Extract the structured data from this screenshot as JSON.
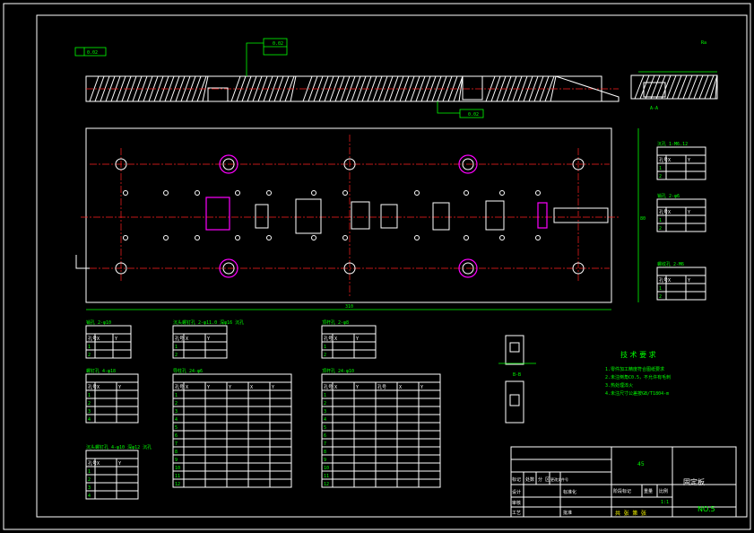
{
  "title_block": {
    "drawing_name": "固定板",
    "drawing_no": "NO.5",
    "material": "45",
    "scale": "1:1",
    "sheet_info": "共 张 第 张",
    "header_cells": [
      "标记",
      "处数",
      "分 区",
      "更改文件号"
    ],
    "right_headers": [
      "阶段标记",
      "重量",
      "比例"
    ],
    "left_rows": [
      "设计",
      "审核",
      "工艺"
    ],
    "design_value": "标准化",
    "approve_label": "批准"
  },
  "tech_req": {
    "title": "技 术 要 求",
    "lines": [
      "1.零件加工精度符合图纸要求",
      "2.未注倒角C0.5，不允许有毛刺",
      "3.热处理淬火",
      "4.未注尺寸公差按GB/T1804-m"
    ]
  },
  "labels": {
    "flatness": "0.02",
    "parallel": "0.02",
    "perp": "0.02",
    "roughness": "Ra",
    "section_aa": "A-A",
    "section_bb": "B-B",
    "dim_total": "310",
    "dim_height": "80"
  },
  "tables": {
    "t_sr": {
      "title": "沉孔 1-M6.12",
      "headers": [
        "孔号",
        "X",
        "Y"
      ],
      "rows": [
        [
          "1",
          "",
          ""
        ],
        [
          "2",
          "",
          ""
        ]
      ]
    },
    "t_r1": {
      "title": "销孔 2-φ6",
      "headers": [
        "孔号",
        "X",
        "Y"
      ],
      "rows": [
        [
          "1",
          "",
          ""
        ],
        [
          "2",
          "",
          ""
        ]
      ]
    },
    "t_r2": {
      "title": "螺纹孔 2-M6",
      "headers": [
        "孔号",
        "X",
        "Y"
      ],
      "rows": [
        [
          "1",
          "",
          ""
        ],
        [
          "2",
          "",
          ""
        ]
      ]
    },
    "t_a": {
      "title": "销孔 2-φ10",
      "headers": [
        "孔号",
        "X",
        "Y"
      ],
      "rows": [
        [
          "1",
          "",
          ""
        ],
        [
          "2",
          "",
          ""
        ]
      ]
    },
    "t_b": {
      "title": "沉头螺钉孔 2-φ11.0 深φ16 沉孔",
      "headers": [
        "孔号",
        "X",
        "Y"
      ],
      "rows": [
        [
          "1",
          "",
          ""
        ],
        [
          "2",
          "",
          ""
        ]
      ]
    },
    "t_c": {
      "title": "顶杆孔 2-φ8",
      "headers": [
        "孔号",
        "X",
        "Y"
      ],
      "rows": [
        [
          "1",
          "",
          ""
        ],
        [
          "2",
          "",
          ""
        ]
      ]
    },
    "t_d": {
      "title": "螺钉孔 4-φ18",
      "headers": [
        "孔号",
        "X",
        "Y"
      ],
      "rows": [
        [
          "1",
          "",
          ""
        ],
        [
          "2",
          "",
          ""
        ],
        [
          "3",
          "",
          ""
        ],
        [
          "4",
          "",
          ""
        ]
      ]
    },
    "t_e": {
      "title": "沉头螺钉孔 4-φ10 深φ12 沉孔",
      "headers": [
        "孔号",
        "X",
        "Y"
      ],
      "rows": [
        [
          "1",
          "",
          ""
        ],
        [
          "2",
          "",
          ""
        ],
        [
          "3",
          "",
          ""
        ],
        [
          "4",
          "",
          ""
        ]
      ]
    },
    "t_f": {
      "title": "导柱孔 24-φ6",
      "headers": [
        "孔号",
        "X",
        "Y",
        "Y",
        "X",
        "Y"
      ],
      "rows": [
        [
          "1",
          "",
          "",
          "",
          "",
          ""
        ],
        [
          "2",
          "",
          "",
          "",
          "",
          ""
        ],
        [
          "3",
          "",
          "",
          "",
          "",
          ""
        ],
        [
          "4",
          "",
          "",
          "",
          "",
          ""
        ],
        [
          "5",
          "",
          "",
          "",
          "",
          ""
        ],
        [
          "6",
          "",
          "",
          "",
          "",
          ""
        ],
        [
          "7",
          "",
          "",
          "",
          "",
          ""
        ],
        [
          "8",
          "",
          "",
          "",
          "",
          ""
        ],
        [
          "9",
          "",
          "",
          "",
          "",
          ""
        ],
        [
          "10",
          "",
          "",
          "",
          "",
          ""
        ],
        [
          "11",
          "",
          "",
          "",
          "",
          ""
        ],
        [
          "12",
          "",
          "",
          "",
          "",
          ""
        ]
      ]
    },
    "t_g": {
      "title": "顶杆孔 24-φ10",
      "headers": [
        "孔号",
        "X",
        "Y",
        "孔号",
        "X",
        "Y"
      ],
      "rows": [
        [
          "1",
          "",
          "",
          "",
          "",
          ""
        ],
        [
          "2",
          "",
          "",
          "",
          "",
          ""
        ],
        [
          "3",
          "",
          "",
          "",
          "",
          ""
        ],
        [
          "4",
          "",
          "",
          "",
          "",
          ""
        ],
        [
          "5",
          "",
          "",
          "",
          "",
          ""
        ],
        [
          "6",
          "",
          "",
          "",
          "",
          ""
        ],
        [
          "7",
          "",
          "",
          "",
          "",
          ""
        ],
        [
          "8",
          "",
          "",
          "",
          "",
          ""
        ],
        [
          "9",
          "",
          "",
          "",
          "",
          ""
        ],
        [
          "10",
          "",
          "",
          "",
          "",
          ""
        ],
        [
          "11",
          "",
          "",
          "",
          "",
          ""
        ],
        [
          "12",
          "",
          "",
          "",
          "",
          ""
        ]
      ]
    }
  }
}
